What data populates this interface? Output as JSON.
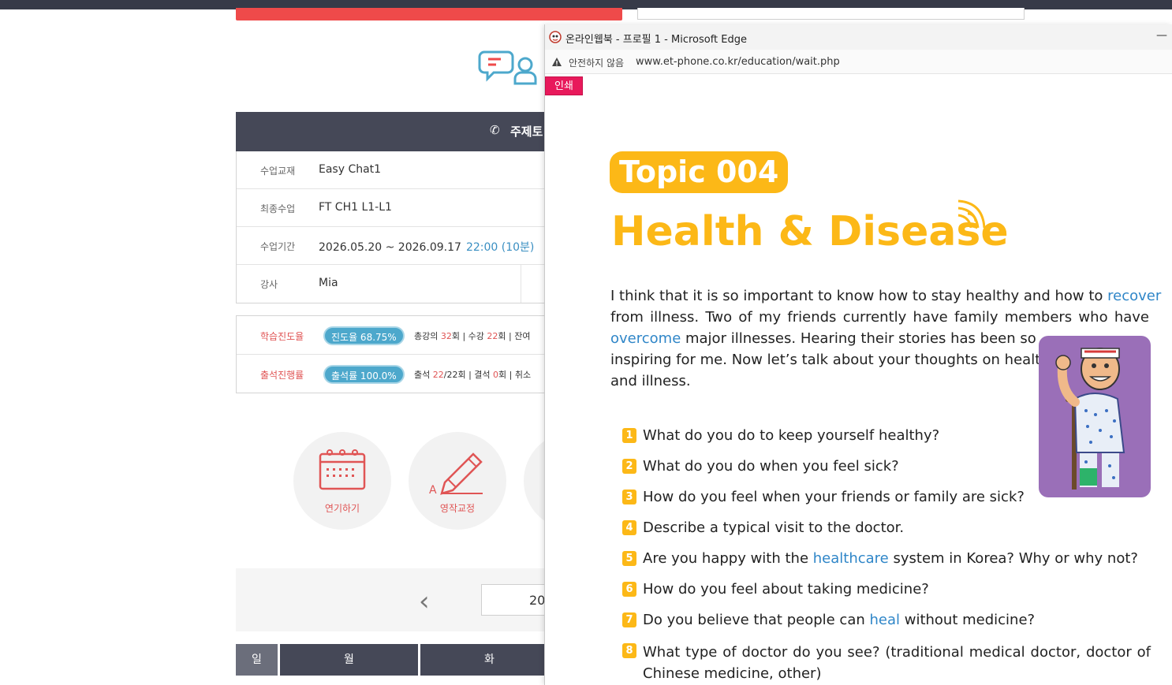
{
  "background_page": {
    "header_title": "주제토",
    "info": [
      {
        "label": "수업교재",
        "value": "Easy Chat1",
        "extra": ""
      },
      {
        "label": "최종수업",
        "value": "FT CH1 L1-L1",
        "extra": ""
      },
      {
        "label": "수업기간",
        "value": "2026.05.20 ~ 2026.09.17",
        "extra": "22:00 (10분)"
      },
      {
        "label": "강사",
        "value": "Mia",
        "extra": ""
      }
    ],
    "progress": [
      {
        "label": "학습진도율",
        "pill": "진도율 68.75%",
        "text_pre": "총강의 ",
        "num1": "32",
        "text_mid": "회 | 수강 ",
        "num2": "22",
        "text_post": "회 | 잔여"
      },
      {
        "label": "출석진행률",
        "pill": "출석률 100.0%",
        "text_pre": "출석 ",
        "num1": "22",
        "text_mid": "/22회 | 결석 ",
        "num2": "0",
        "text_post": "회 | 취소"
      }
    ],
    "buttons": [
      {
        "label": "연기하기"
      },
      {
        "label": "영작교정"
      }
    ],
    "calendar": {
      "prev_icon": "chevron-left-icon",
      "year_partial": "20",
      "days": [
        "일",
        "월",
        "화"
      ]
    }
  },
  "popup": {
    "window_title": "온라인웹북 - 프로필 1 - Microsoft Edge",
    "minimize_label": "—",
    "security_text": "안전하지 않음",
    "url": "www.et-phone.co.kr/education/wait.php",
    "print_label": "인쇄",
    "topic_badge": "Topic 004",
    "title": "Health & Disease",
    "intro": {
      "l1a": "I think that it is so important to know how to stay healthy and how to ",
      "l1k": "recover",
      "l2": "from illness. Two of my friends currently have family members who have",
      "l3k": "overcome",
      "l3b": " major illnesses. Hearing their stories has been so",
      "l4": "inspiring for me. Now let’s talk about your thoughts on health",
      "l5": "and illness."
    },
    "questions": [
      {
        "num": "1",
        "pre": "What do you do to keep yourself healthy?",
        "kw": "",
        "post": ""
      },
      {
        "num": "2",
        "pre": "What do you do when you feel sick?",
        "kw": "",
        "post": ""
      },
      {
        "num": "3",
        "pre": "How do you feel when your friends or family are sick?",
        "kw": "",
        "post": ""
      },
      {
        "num": "4",
        "pre": "Describe a typical visit to the doctor.",
        "kw": "",
        "post": ""
      },
      {
        "num": "5",
        "pre": "Are you happy with the ",
        "kw": "healthcare",
        "post": " system in Korea? Why or why not?"
      },
      {
        "num": "6",
        "pre": "How do you feel about taking medicine?",
        "kw": "",
        "post": ""
      },
      {
        "num": "7",
        "pre": "Do you believe that people can ",
        "kw": "heal",
        "post": " without medicine?"
      },
      {
        "num": "8",
        "pre": "What type of doctor do you see? (traditional medical doctor, doctor of Chinese medicine, other)",
        "kw": "",
        "post": ""
      }
    ]
  },
  "colors": {
    "accent_yellow": "#fcb817",
    "keyword_blue": "#2f86c8",
    "print_pink": "#e8195b",
    "header_dark": "#454857",
    "label_red": "#e05555",
    "pill_blue": "#4da8cc"
  }
}
